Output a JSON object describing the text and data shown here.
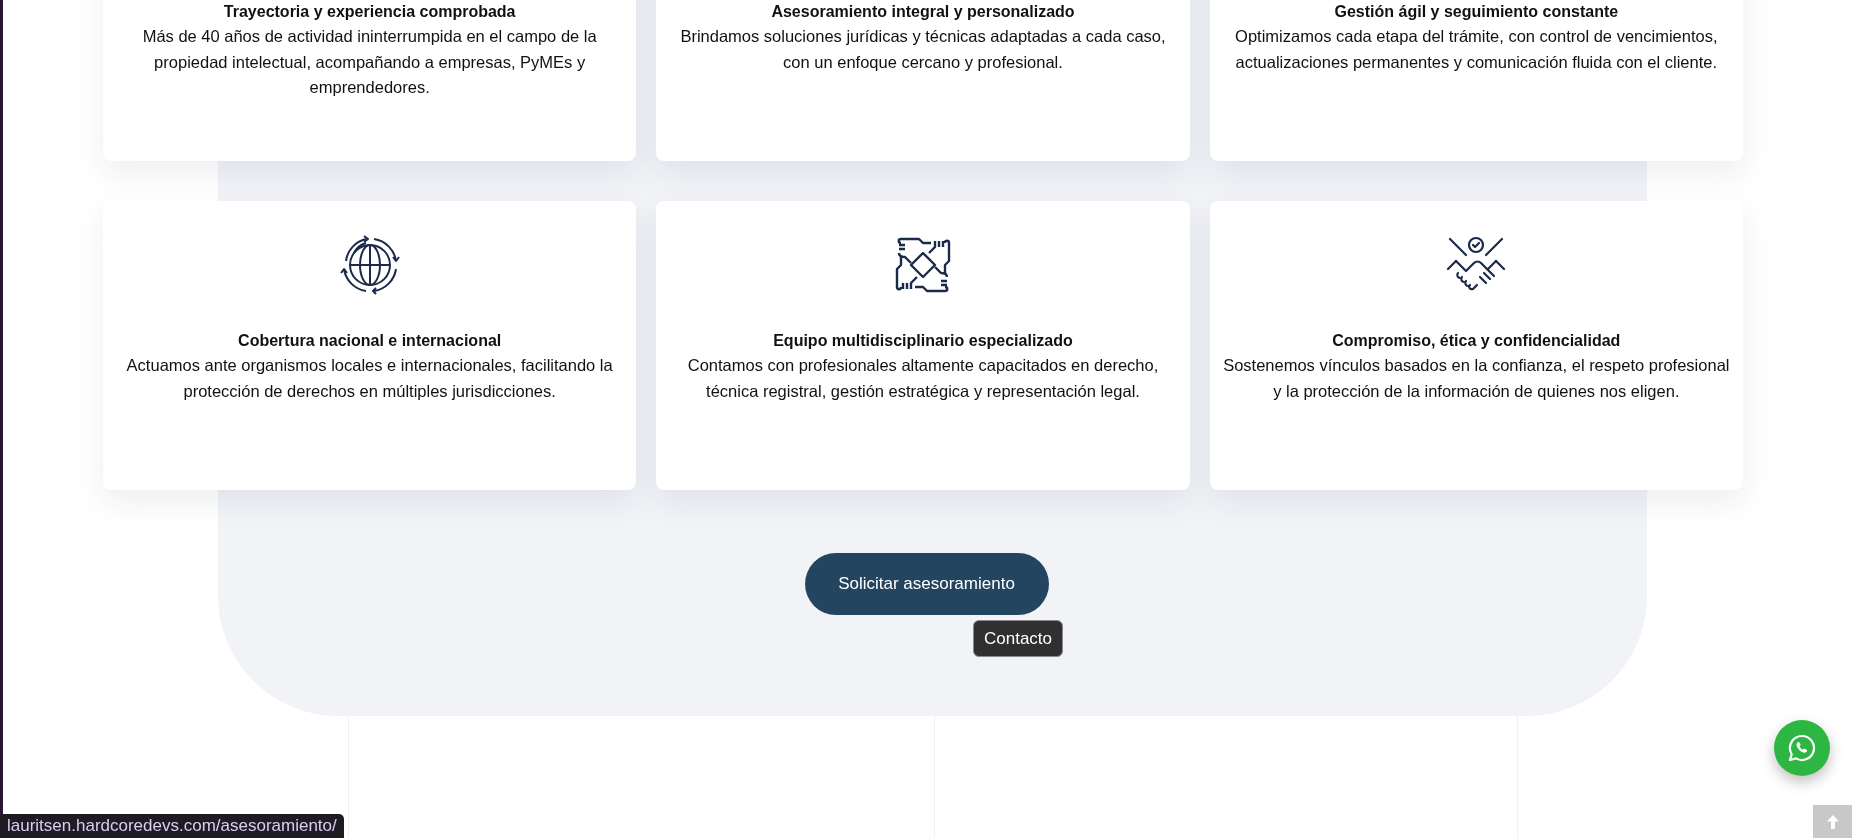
{
  "card_rows": [
    [
      {
        "title": "Trayectoria y experiencia comprobada",
        "text": "Más de 40 años de actividad ininterrumpida en el campo de la propiedad intelectual, acompañando a empresas, PyMEs y emprendedores."
      },
      {
        "title": "Asesoramiento integral y personalizado",
        "text": "Brindamos soluciones jurídicas y técnicas adaptadas a cada caso, con un enfoque cercano y profesional."
      },
      {
        "title": "Gestión ágil y seguimiento constante",
        "text": "Optimizamos cada etapa del trámite, con control de vencimientos, actualizaciones permanentes y comunicación fluida con el cliente."
      }
    ],
    [
      {
        "title": "Cobertura nacional e internacional",
        "text": "Actuamos ante organismos locales e internacionales, facilitando la protección de derechos en múltiples jurisdicciones."
      },
      {
        "title": "Equipo multidisciplinario especializado",
        "text": "Contamos con profesionales altamente capacitados en derecho, técnica registral, gestión estratégica y representación legal."
      },
      {
        "title": "Compromiso, ética y confidencialidad",
        "text": "Sostenemos vínculos basados en la confianza, el respeto profesional y la protección de la información de quienes nos eligen."
      }
    ]
  ],
  "cta_button": "Solicitar asesoramiento",
  "tooltip": "Contacto",
  "status_url": "lauritsen.hardcoredevs.com/asesoramiento/"
}
